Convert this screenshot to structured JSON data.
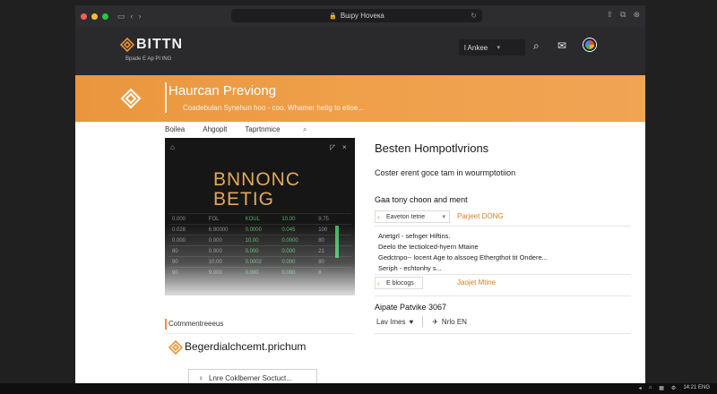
{
  "browser": {
    "url": "Bшpy Hoveкa",
    "dots": [
      "#ff5f57",
      "#febc2e",
      "#28c840"
    ]
  },
  "header": {
    "brand": "BITTN",
    "brand_sub": "Bрade E Ap PI tNG",
    "language": "l Ankee",
    "accent": "#e79436"
  },
  "banner": {
    "title": "Hаurcan Previong",
    "subtitle": "Coadebulan Synehun hoo - coo. Whamer hetig to etioe..."
  },
  "tabs": {
    "items": [
      "Boilea",
      "Ahgoplt",
      "Taprtnmice"
    ]
  },
  "hero": {
    "title": "BNNONC\nBETIG",
    "rows": [
      [
        "0.000",
        "FOL",
        "KOUL",
        "10.00",
        "9.75"
      ],
      [
        "0.028",
        "6.90000",
        "0.0000",
        "0.045",
        "100"
      ],
      [
        "0.000",
        "0.000",
        "10.00",
        "0.0000",
        "80"
      ],
      [
        "80",
        "0.000",
        "0.000",
        "0.000",
        "21"
      ],
      [
        "90",
        "10.00",
        "0.0002",
        "0.000",
        "80"
      ],
      [
        "90",
        "9.000",
        "0.000",
        "0.000",
        "8"
      ]
    ]
  },
  "sidebar": {
    "heading": "Cotmmentreeeus",
    "link": "Begerdialchcemt.prichum",
    "button": "Lnre Coklberner Soctuct..."
  },
  "right": {
    "title": "Besten Hompotlvrions",
    "subtitle": "Coster erent goce tam in wourmptotiion",
    "section1": "Gaa tony choon and ment",
    "select1": "Eaveton tetne",
    "link1": "Parjeet DONG",
    "list": [
      "Anetgrl - sefnger Hiftins.",
      "Deelo the tectiolced-hyern Mtaine",
      "Gedctnpo-- locent Age to alssoeg Ethergthot tit Ondere...",
      "Seriph - echtonhy s..."
    ],
    "select2": "E blocogs",
    "link2": "Jaojet Mtine",
    "section2": "Aipate Patvike 3067",
    "action1": "Lav Imes",
    "action2": "Nrlo EN"
  },
  "taskbar": {
    "items": [
      "◂",
      "⌂",
      "▦",
      "⚙",
      "14:21 ENG"
    ]
  }
}
